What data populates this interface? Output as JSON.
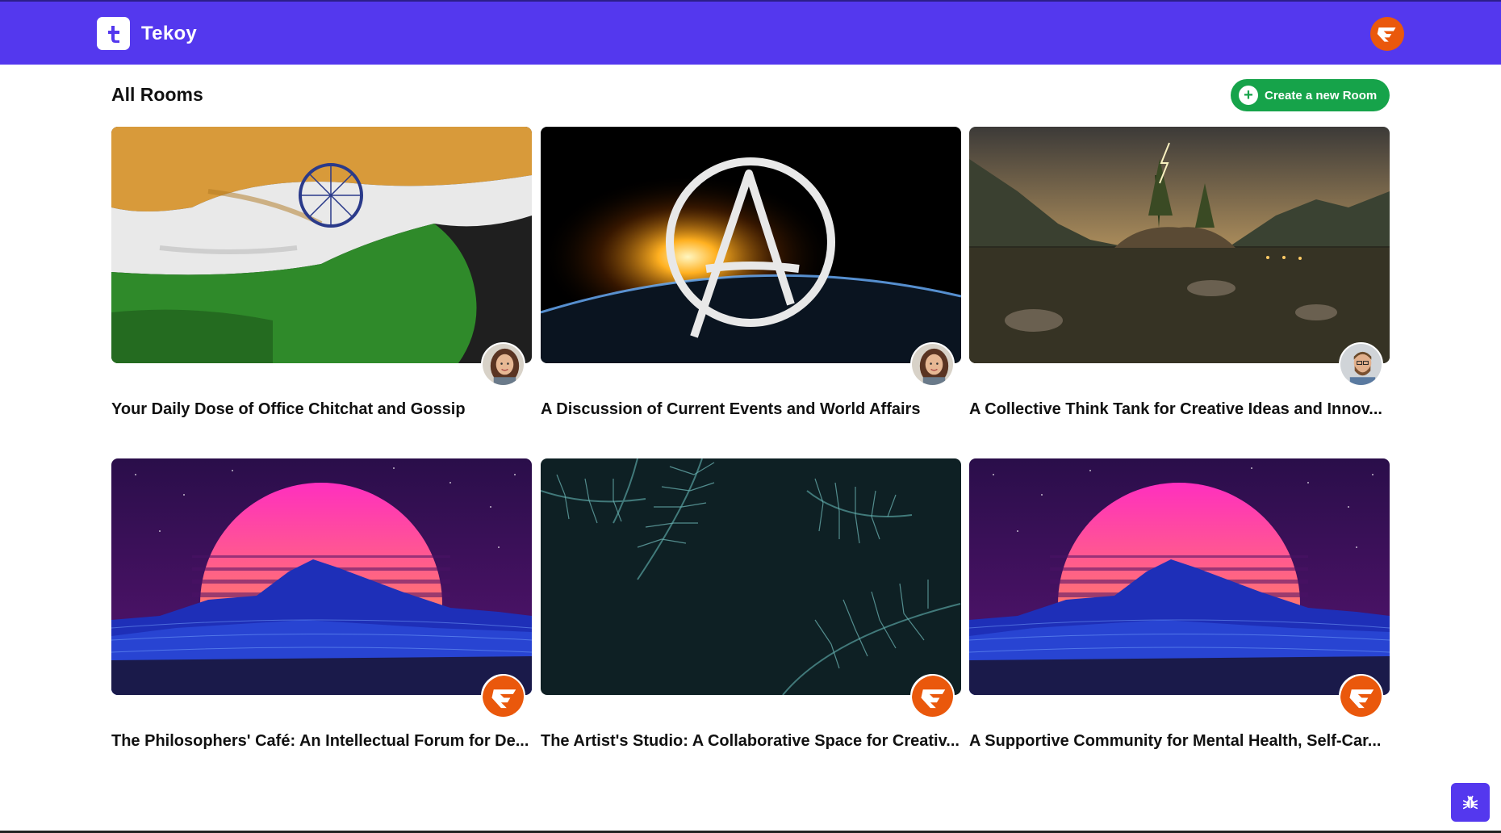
{
  "header": {
    "brand_name": "Tekoy",
    "brand_icon": "tekoy-logo-icon",
    "user_icon": "user-avatar-icon",
    "accent": "#5438ee"
  },
  "page": {
    "title": "All Rooms",
    "create_button_label": "Create a new Room",
    "create_button_color": "#16a34a"
  },
  "rooms": [
    {
      "title": "Your Daily Dose of Office Chitchat and Gossip",
      "thumbnail": "india-flag",
      "owner_avatar": "woman-avatar"
    },
    {
      "title": "A Discussion of Current Events and World Affairs",
      "thumbnail": "anarchy-symbol-planet",
      "owner_avatar": "woman-avatar"
    },
    {
      "title": "A Collective Think Tank for Creative Ideas and Innov...",
      "thumbnail": "lake-landscape-storm",
      "owner_avatar": "man-avatar"
    },
    {
      "title": "The Philosophers' Café: An Intellectual Forum for De...",
      "thumbnail": "synthwave-sunset",
      "owner_avatar": "tekoy-default-avatar"
    },
    {
      "title": "The Artist's Studio: A Collaborative Space for Creativ...",
      "thumbnail": "pine-branches",
      "owner_avatar": "tekoy-default-avatar"
    },
    {
      "title": "A Supportive Community for Mental Health, Self-Car...",
      "thumbnail": "synthwave-sunset",
      "owner_avatar": "tekoy-default-avatar"
    }
  ],
  "bug_report_icon": "bug-icon"
}
